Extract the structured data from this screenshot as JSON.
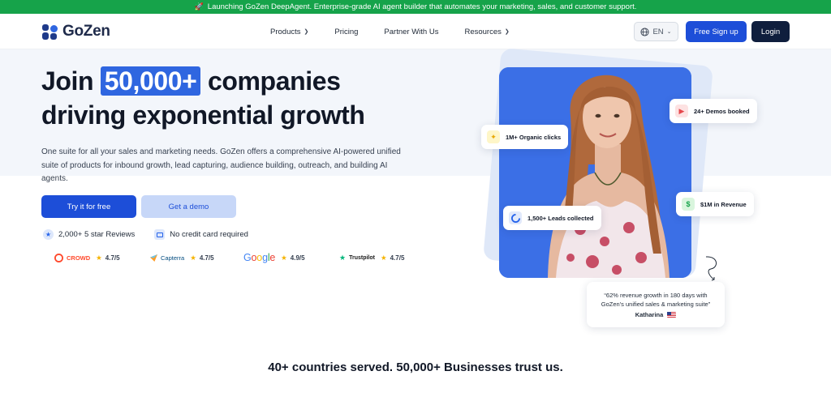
{
  "announcement": {
    "icon": "rocket-icon",
    "text": "Launching GoZen DeepAgent. Enterprise-grade AI agent builder that automates your marketing, sales, and customer support."
  },
  "header": {
    "logo_text": "GoZen",
    "nav": [
      {
        "label": "Products",
        "dropdown": true
      },
      {
        "label": "Pricing",
        "dropdown": false
      },
      {
        "label": "Partner With Us",
        "dropdown": false
      },
      {
        "label": "Resources",
        "dropdown": true
      }
    ],
    "language": "EN",
    "signup_label": "Free Sign up",
    "login_label": "Login"
  },
  "hero": {
    "headline_pre": "Join",
    "headline_highlight": "50,000+",
    "headline_post": "companies",
    "headline_line2": "driving exponential growth",
    "subtext": "One suite for all your sales and marketing needs. GoZen offers a comprehensive AI-powered unified suite of products for inbound growth, lead capturing, audience building, outreach, and building AI agents.",
    "try_label": "Try it for free",
    "demo_label": "Get a demo",
    "badges": [
      {
        "icon": "star-icon",
        "text": "2,000+ 5 star Reviews"
      },
      {
        "icon": "credit-card-icon",
        "text": "No credit card required"
      }
    ],
    "ratings": [
      {
        "brand": "CROWD",
        "score": "4.7/5",
        "color": "#ff492c"
      },
      {
        "brand": "Capterra",
        "score": "4.7/5",
        "color": "#044d80"
      },
      {
        "brand": "Google",
        "score": "4.9/5",
        "color": "#4285f4"
      },
      {
        "brand": "Trustpilot",
        "score": "4.7/5",
        "color": "#00b67a"
      }
    ]
  },
  "visual": {
    "stats": [
      {
        "text": "24+ Demos booked",
        "icon": "play-icon"
      },
      {
        "text": "1M+ Organic clicks",
        "icon": "sparkle-icon"
      },
      {
        "text": "$1M in Revenue",
        "icon": "dollar-icon"
      },
      {
        "text": "1,500+ Leads collected",
        "icon": "progress-icon"
      }
    ],
    "quote": {
      "text_line1": "“62% revenue growth in 180 days with",
      "text_line2": "GoZen's unified sales & marketing suite”",
      "author": "Katharina"
    }
  },
  "trust_line": "40+ countries served. 50,000+ Businesses trust us.",
  "colors": {
    "primary": "#1d4ed8",
    "announcement_bg": "#16a34a",
    "login_bg": "#0f1e3d",
    "highlight": "#2f66e0"
  }
}
